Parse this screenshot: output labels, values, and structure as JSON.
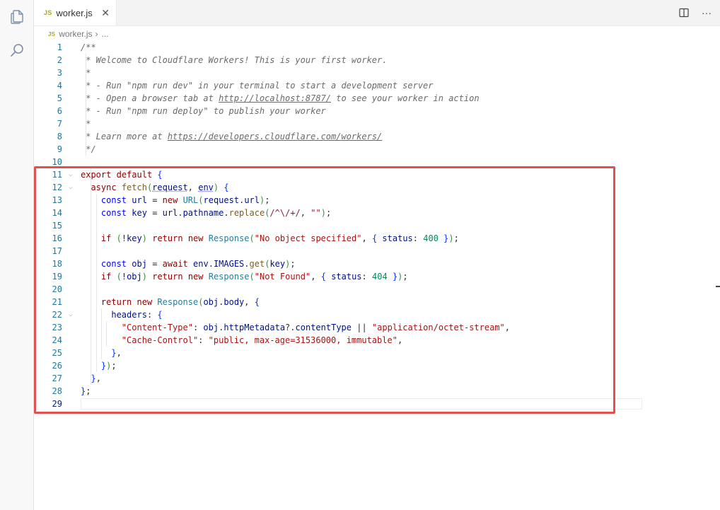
{
  "tab": {
    "badge": "JS",
    "file_name": "worker.js",
    "close_glyph": "✕"
  },
  "breadcrumb": {
    "badge": "JS",
    "file": "worker.js",
    "separator": "›",
    "more": "..."
  },
  "tab_actions": {
    "more_glyph": "···"
  },
  "icons": {
    "explorer": "files-icon",
    "search": "search-icon",
    "split": "split-editor-icon",
    "more": "more-actions-icon"
  },
  "colors": {
    "highlight_border": "#e05252"
  },
  "editor": {
    "active_line": 29,
    "lines": [
      {
        "n": "1",
        "text": "/**"
      },
      {
        "n": "2",
        "text": " * Welcome to Cloudflare Workers! This is your first worker."
      },
      {
        "n": "3",
        "text": " *"
      },
      {
        "n": "4",
        "text": " * - Run \"npm run dev\" in your terminal to start a development server"
      },
      {
        "n": "5",
        "text": " * - Open a browser tab at http://localhost:8787/ to see your worker in action"
      },
      {
        "n": "6",
        "text": " * - Run \"npm run deploy\" to publish your worker"
      },
      {
        "n": "7",
        "text": " *"
      },
      {
        "n": "8",
        "text": " * Learn more at https://developers.cloudflare.com/workers/"
      },
      {
        "n": "9",
        "text": " */"
      },
      {
        "n": "10",
        "text": ""
      },
      {
        "n": "11",
        "text": "export default {"
      },
      {
        "n": "12",
        "text": "  async fetch(request, env) {"
      },
      {
        "n": "13",
        "text": "    const url = new URL(request.url);"
      },
      {
        "n": "14",
        "text": "    const key = url.pathname.replace(/^\\/+/, \"\");"
      },
      {
        "n": "15",
        "text": ""
      },
      {
        "n": "16",
        "text": "    if (!key) return new Response(\"No object specified\", { status: 400 });"
      },
      {
        "n": "17",
        "text": ""
      },
      {
        "n": "18",
        "text": "    const obj = await env.IMAGES.get(key);"
      },
      {
        "n": "19",
        "text": "    if (!obj) return new Response(\"Not Found\", { status: 404 });"
      },
      {
        "n": "20",
        "text": ""
      },
      {
        "n": "21",
        "text": "    return new Response(obj.body, {"
      },
      {
        "n": "22",
        "text": "      headers: {"
      },
      {
        "n": "23",
        "text": "        \"Content-Type\": obj.httpMetadata?.contentType || \"application/octet-stream\","
      },
      {
        "n": "24",
        "text": "        \"Cache-Control\": \"public, max-age=31536000, immutable\","
      },
      {
        "n": "25",
        "text": "      },"
      },
      {
        "n": "26",
        "text": "    });"
      },
      {
        "n": "27",
        "text": "  },"
      },
      {
        "n": "28",
        "text": "};"
      },
      {
        "n": "29",
        "text": ""
      }
    ]
  }
}
